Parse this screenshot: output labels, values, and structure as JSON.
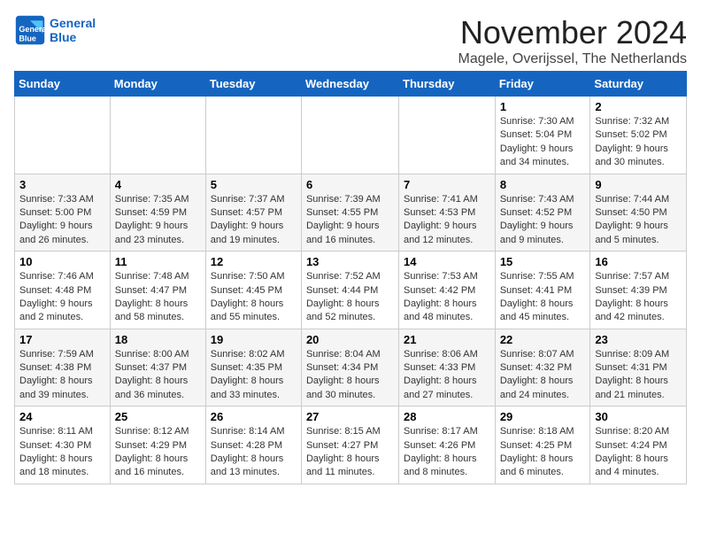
{
  "logo": {
    "line1": "General",
    "line2": "Blue"
  },
  "title": "November 2024",
  "location": "Magele, Overijssel, The Netherlands",
  "days_of_week": [
    "Sunday",
    "Monday",
    "Tuesday",
    "Wednesday",
    "Thursday",
    "Friday",
    "Saturday"
  ],
  "weeks": [
    [
      {
        "day": "",
        "info": ""
      },
      {
        "day": "",
        "info": ""
      },
      {
        "day": "",
        "info": ""
      },
      {
        "day": "",
        "info": ""
      },
      {
        "day": "",
        "info": ""
      },
      {
        "day": "1",
        "info": "Sunrise: 7:30 AM\nSunset: 5:04 PM\nDaylight: 9 hours and 34 minutes."
      },
      {
        "day": "2",
        "info": "Sunrise: 7:32 AM\nSunset: 5:02 PM\nDaylight: 9 hours and 30 minutes."
      }
    ],
    [
      {
        "day": "3",
        "info": "Sunrise: 7:33 AM\nSunset: 5:00 PM\nDaylight: 9 hours and 26 minutes."
      },
      {
        "day": "4",
        "info": "Sunrise: 7:35 AM\nSunset: 4:59 PM\nDaylight: 9 hours and 23 minutes."
      },
      {
        "day": "5",
        "info": "Sunrise: 7:37 AM\nSunset: 4:57 PM\nDaylight: 9 hours and 19 minutes."
      },
      {
        "day": "6",
        "info": "Sunrise: 7:39 AM\nSunset: 4:55 PM\nDaylight: 9 hours and 16 minutes."
      },
      {
        "day": "7",
        "info": "Sunrise: 7:41 AM\nSunset: 4:53 PM\nDaylight: 9 hours and 12 minutes."
      },
      {
        "day": "8",
        "info": "Sunrise: 7:43 AM\nSunset: 4:52 PM\nDaylight: 9 hours and 9 minutes."
      },
      {
        "day": "9",
        "info": "Sunrise: 7:44 AM\nSunset: 4:50 PM\nDaylight: 9 hours and 5 minutes."
      }
    ],
    [
      {
        "day": "10",
        "info": "Sunrise: 7:46 AM\nSunset: 4:48 PM\nDaylight: 9 hours and 2 minutes."
      },
      {
        "day": "11",
        "info": "Sunrise: 7:48 AM\nSunset: 4:47 PM\nDaylight: 8 hours and 58 minutes."
      },
      {
        "day": "12",
        "info": "Sunrise: 7:50 AM\nSunset: 4:45 PM\nDaylight: 8 hours and 55 minutes."
      },
      {
        "day": "13",
        "info": "Sunrise: 7:52 AM\nSunset: 4:44 PM\nDaylight: 8 hours and 52 minutes."
      },
      {
        "day": "14",
        "info": "Sunrise: 7:53 AM\nSunset: 4:42 PM\nDaylight: 8 hours and 48 minutes."
      },
      {
        "day": "15",
        "info": "Sunrise: 7:55 AM\nSunset: 4:41 PM\nDaylight: 8 hours and 45 minutes."
      },
      {
        "day": "16",
        "info": "Sunrise: 7:57 AM\nSunset: 4:39 PM\nDaylight: 8 hours and 42 minutes."
      }
    ],
    [
      {
        "day": "17",
        "info": "Sunrise: 7:59 AM\nSunset: 4:38 PM\nDaylight: 8 hours and 39 minutes."
      },
      {
        "day": "18",
        "info": "Sunrise: 8:00 AM\nSunset: 4:37 PM\nDaylight: 8 hours and 36 minutes."
      },
      {
        "day": "19",
        "info": "Sunrise: 8:02 AM\nSunset: 4:35 PM\nDaylight: 8 hours and 33 minutes."
      },
      {
        "day": "20",
        "info": "Sunrise: 8:04 AM\nSunset: 4:34 PM\nDaylight: 8 hours and 30 minutes."
      },
      {
        "day": "21",
        "info": "Sunrise: 8:06 AM\nSunset: 4:33 PM\nDaylight: 8 hours and 27 minutes."
      },
      {
        "day": "22",
        "info": "Sunrise: 8:07 AM\nSunset: 4:32 PM\nDaylight: 8 hours and 24 minutes."
      },
      {
        "day": "23",
        "info": "Sunrise: 8:09 AM\nSunset: 4:31 PM\nDaylight: 8 hours and 21 minutes."
      }
    ],
    [
      {
        "day": "24",
        "info": "Sunrise: 8:11 AM\nSunset: 4:30 PM\nDaylight: 8 hours and 18 minutes."
      },
      {
        "day": "25",
        "info": "Sunrise: 8:12 AM\nSunset: 4:29 PM\nDaylight: 8 hours and 16 minutes."
      },
      {
        "day": "26",
        "info": "Sunrise: 8:14 AM\nSunset: 4:28 PM\nDaylight: 8 hours and 13 minutes."
      },
      {
        "day": "27",
        "info": "Sunrise: 8:15 AM\nSunset: 4:27 PM\nDaylight: 8 hours and 11 minutes."
      },
      {
        "day": "28",
        "info": "Sunrise: 8:17 AM\nSunset: 4:26 PM\nDaylight: 8 hours and 8 minutes."
      },
      {
        "day": "29",
        "info": "Sunrise: 8:18 AM\nSunset: 4:25 PM\nDaylight: 8 hours and 6 minutes."
      },
      {
        "day": "30",
        "info": "Sunrise: 8:20 AM\nSunset: 4:24 PM\nDaylight: 8 hours and 4 minutes."
      }
    ]
  ]
}
